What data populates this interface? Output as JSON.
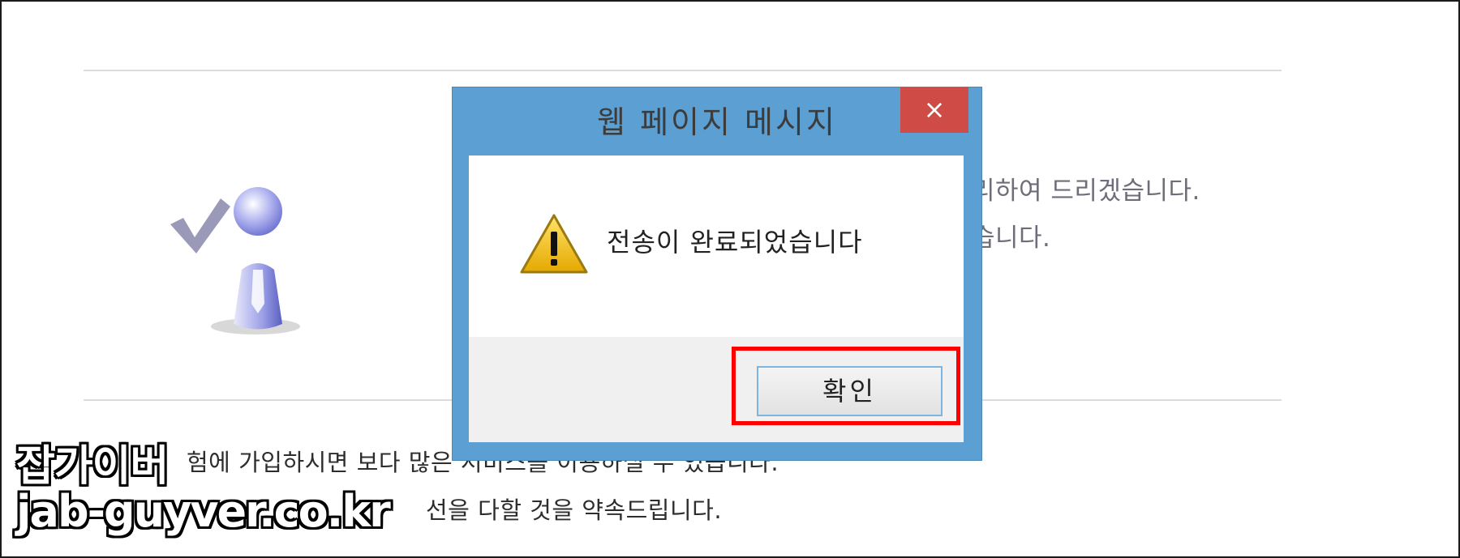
{
  "background": {
    "line1": "리하여 드리겠습니다.",
    "line2": "습니다.",
    "line3": "험에 가입하시면 보다 많은 서비스를 이용하실 수 있습니다.",
    "line4": "선을 다할 것을 약속드립니다."
  },
  "dialog": {
    "title": "웹 페이지 메시지",
    "close_glyph": "×",
    "message": "전송이 완료되었습니다",
    "ok_label": "확인"
  },
  "watermark": {
    "line1": "잡가이버",
    "line2": "jab-guyver.co.kr"
  },
  "colors": {
    "dialog_frame": "#5b9fd3",
    "close_button": "#cf4b45",
    "highlight": "#ff0000"
  }
}
